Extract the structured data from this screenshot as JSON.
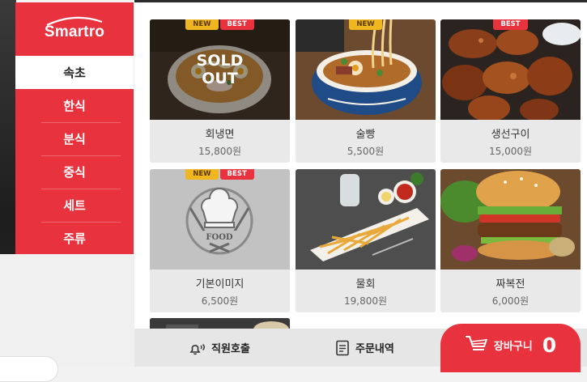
{
  "brand": {
    "logo_text": "Smartro"
  },
  "sidebar": {
    "items": [
      {
        "label": "속초",
        "active": true
      },
      {
        "label": "한식",
        "active": false
      },
      {
        "label": "분식",
        "active": false
      },
      {
        "label": "중식",
        "active": false
      },
      {
        "label": "세트",
        "active": false
      },
      {
        "label": "주류",
        "active": false
      }
    ]
  },
  "menu": {
    "items": [
      {
        "name": "회냉면",
        "price": "15,800원",
        "badges": [
          "NEW",
          "BEST"
        ],
        "sold_out_line1": "SOLD",
        "sold_out_line2": "OUT"
      },
      {
        "name": "술빵",
        "price": "5,500원",
        "badges": [
          "NEW"
        ]
      },
      {
        "name": "생선구이",
        "price": "15,000원",
        "badges": [
          "BEST"
        ]
      },
      {
        "name": "기본이미지",
        "price": "6,500원",
        "badges": [
          "NEW",
          "BEST"
        ],
        "placeholder_text": "FOOD"
      },
      {
        "name": "물회",
        "price": "19,800원",
        "badges": []
      },
      {
        "name": "짜복전",
        "price": "6,000원",
        "badges": []
      }
    ]
  },
  "bottom_bar": {
    "call_staff_label": "직원호출",
    "order_history_label": "주문내역",
    "cart_label": "장바구니",
    "cart_count": "0"
  },
  "colors": {
    "accent": "#e8333f",
    "new_badge": "#f0b620"
  },
  "icons": [
    "bell-icon",
    "receipt-icon",
    "cart-icon",
    "chef-hat-icon"
  ]
}
